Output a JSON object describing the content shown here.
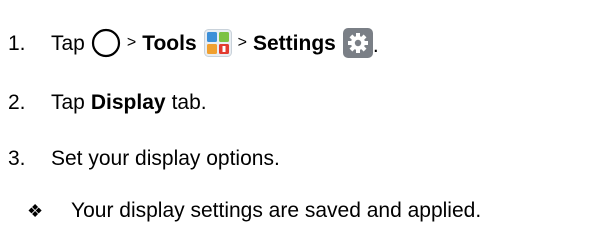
{
  "steps": [
    {
      "number": "1.",
      "tap_word": "Tap",
      "home_icon": "home-circle-icon",
      "separator1": ">",
      "tools_label": "Tools",
      "tools_icon": "tools-folder-icon",
      "separator2": ">",
      "settings_label": "Settings",
      "settings_icon": "settings-gear-icon",
      "end_punct": "."
    },
    {
      "number": "2.",
      "text_before": "Tap",
      "bold_text": "Display",
      "text_after": "tab."
    },
    {
      "number": "3.",
      "text": "Set your display options."
    }
  ],
  "result": {
    "bullet_icon": "diamond-bullet-icon",
    "text": "Your display settings are saved and applied."
  },
  "colors": {
    "text": "#000000",
    "tools_icon_blue": "#3d8fd8",
    "tools_icon_orange": "#f0a030",
    "tools_icon_green": "#7cc243",
    "tools_icon_red": "#e23b2f",
    "settings_icon_gray": "#7a7f86"
  }
}
